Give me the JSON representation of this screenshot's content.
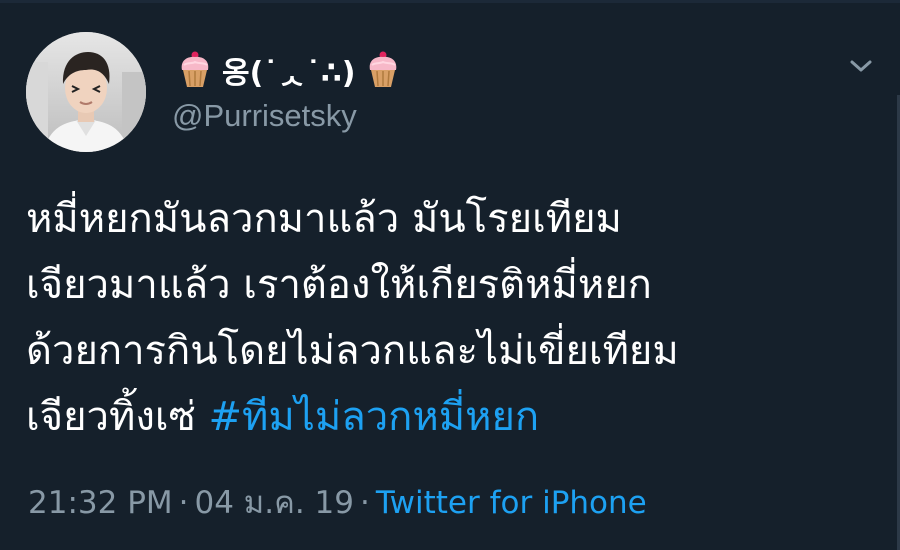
{
  "user": {
    "display_name": "옹(˙ᆺ˙∴)",
    "handle": "@Purrisetsky",
    "avatar": "profile-photo",
    "name_decoration_icon": "cupcake-icon"
  },
  "tweet": {
    "lines": [
      "หมี่หยกมันลวกมาแล้ว มันโรยเทียม",
      "เจียวมาแล้ว เราต้องให้เกียรติหมี่หยก",
      "ด้วยการกินโดยไม่ลวกและไม่เขี่ยเทียม"
    ],
    "last_line_text": "เจียวทิ้งเซ่ ",
    "hashtag": "#ทีมไม่ลวกหมี่หยก"
  },
  "meta": {
    "time": "21:32 PM",
    "separator": "·",
    "date": "04 ม.ค. 19",
    "source": "Twitter for iPhone"
  },
  "menu_icon": "chevron-down-icon",
  "colors": {
    "background": "#15202b",
    "text": "#ffffff",
    "secondary": "#8899a6",
    "link": "#1da1f2"
  }
}
